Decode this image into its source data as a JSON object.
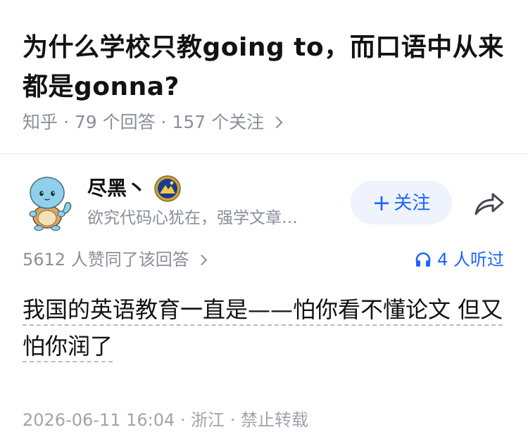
{
  "question": {
    "title": "为什么学校只教going to，而口语中从来都是gonna?",
    "meta": "知乎 · 79 个回答 · 157 个关注"
  },
  "author": {
    "name": "尽黑丶",
    "bio": "欲究代码心犹在，强学文章…",
    "follow_label": "关注",
    "follow_icon": "plus-icon",
    "share_icon": "share-arrow-icon",
    "badge_icon": "achievement-badge-icon",
    "avatar_icon": "squirtle-avatar"
  },
  "stats": {
    "upvotes": "5612 人赞同了该回答",
    "listen": "4 人听过",
    "listen_icon": "headphones-icon"
  },
  "answer": {
    "content": "我国的英语教育一直是——怕你看不懂论文 但又怕你润了"
  },
  "footer": {
    "info": "2026-06-11 16:04 · 浙江 · 禁止转载"
  },
  "colors": {
    "accent": "#1a66ff",
    "follow_bg": "#eef3fe",
    "muted_text": "#8a8f99",
    "divider": "#ebebeb"
  }
}
